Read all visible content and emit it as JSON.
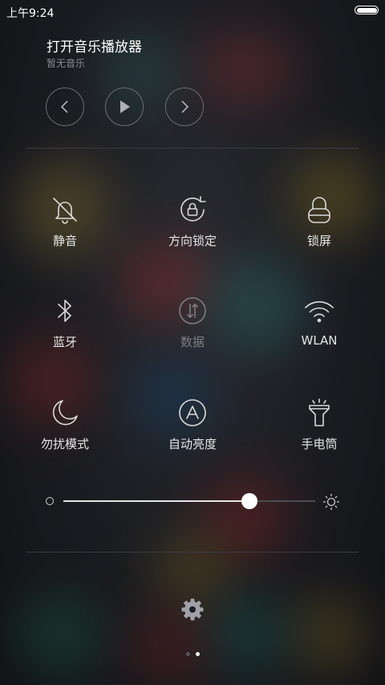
{
  "status_bar": {
    "time": "上午9:24"
  },
  "music": {
    "title": "打开音乐播放器",
    "subtitle": "暂无音乐"
  },
  "media_controls": [
    {
      "name": "previous-icon"
    },
    {
      "name": "play-icon"
    },
    {
      "name": "next-icon"
    }
  ],
  "tiles": [
    {
      "label": "静音",
      "icon": "bell-muted-icon",
      "enabled": true
    },
    {
      "label": "方向锁定",
      "icon": "rotation-lock-icon",
      "enabled": true
    },
    {
      "label": "锁屏",
      "icon": "lock-icon",
      "enabled": true
    },
    {
      "label": "蓝牙",
      "icon": "bluetooth-icon",
      "enabled": true
    },
    {
      "label": "数据",
      "icon": "mobile-data-icon",
      "enabled": false
    },
    {
      "label": "WLAN",
      "icon": "wifi-icon",
      "enabled": true
    },
    {
      "label": "勿扰模式",
      "icon": "moon-icon",
      "enabled": true
    },
    {
      "label": "自动亮度",
      "icon": "auto-brightness-icon",
      "enabled": true
    },
    {
      "label": "手电筒",
      "icon": "flashlight-icon",
      "enabled": true
    }
  ],
  "brightness": {
    "level": 0.74
  },
  "pager": {
    "count": 2,
    "active_index": 1
  },
  "colors": {
    "background": "#1c1d22",
    "icon": "#d9d9d9",
    "icon_disabled": "#7d7e83",
    "accent": "#ffffff"
  }
}
